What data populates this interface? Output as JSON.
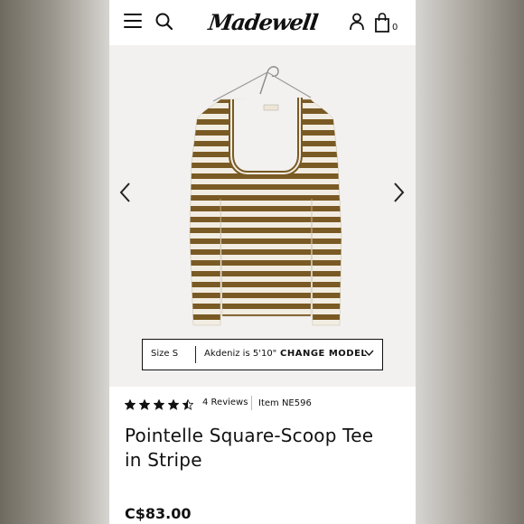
{
  "header": {
    "logo_text": "Madewell",
    "bag_count": "0",
    "icons": [
      "hamburger-menu-icon",
      "search-icon",
      "account-icon",
      "shopping-bag-icon"
    ]
  },
  "gallery": {
    "icons": [
      "chevron-left-icon",
      "chevron-right-icon"
    ],
    "shirt_colors": {
      "stripe": "#7a5a24",
      "base": "#f2ede3"
    }
  },
  "model_selector": {
    "size_label": "Size S",
    "model_info": "Akdeniz is 5'10\"",
    "change_label": "CHANGE MODEL"
  },
  "product": {
    "rating": 4.5,
    "rating_max": 5,
    "reviews_label": "4 Reviews",
    "item_number": "Item NE596",
    "title_line1": "Pointelle Square-Scoop Tee",
    "title_line2": "in Stripe",
    "price": "C$83.00"
  }
}
